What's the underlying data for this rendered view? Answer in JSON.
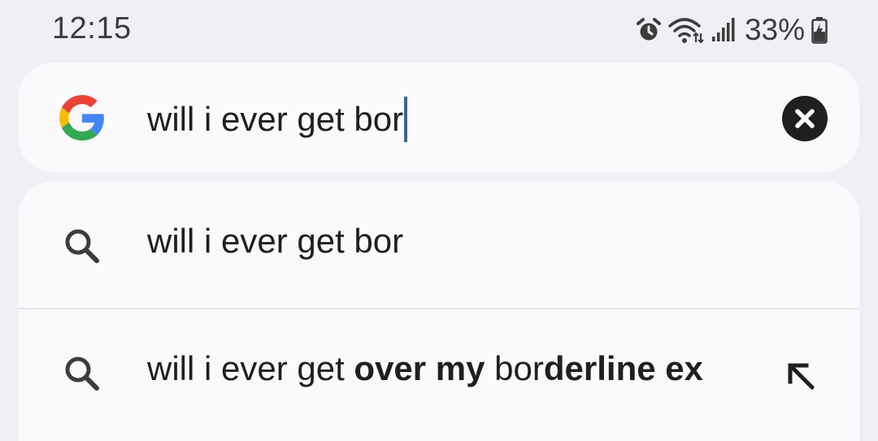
{
  "status_bar": {
    "time": "12:15",
    "battery": "33%",
    "icons": [
      "alarm-icon",
      "wifi-icon",
      "signal-icon",
      "battery-charging-icon"
    ]
  },
  "search": {
    "query": "will i ever get bor",
    "logo": "google-g-logo",
    "clear_icon": "close-icon"
  },
  "suggestions": [
    {
      "text": "will i ever get bor",
      "icon": "search-icon"
    },
    {
      "parts": [
        {
          "text": "will i ever get ",
          "bold": false
        },
        {
          "text": "over my",
          "bold": true
        },
        {
          "text": " bor",
          "bold": false
        },
        {
          "text": "derline ex",
          "bold": true
        }
      ],
      "icon": "search-icon",
      "action_icon": "arrow-up-left-icon"
    }
  ],
  "colors": {
    "background": "#eff0f5",
    "surface": "#fafafd",
    "caret": "#44618f",
    "google_blue": "#4285F4",
    "google_red": "#EA4335",
    "google_yellow": "#FBBC05",
    "google_green": "#34A853"
  }
}
